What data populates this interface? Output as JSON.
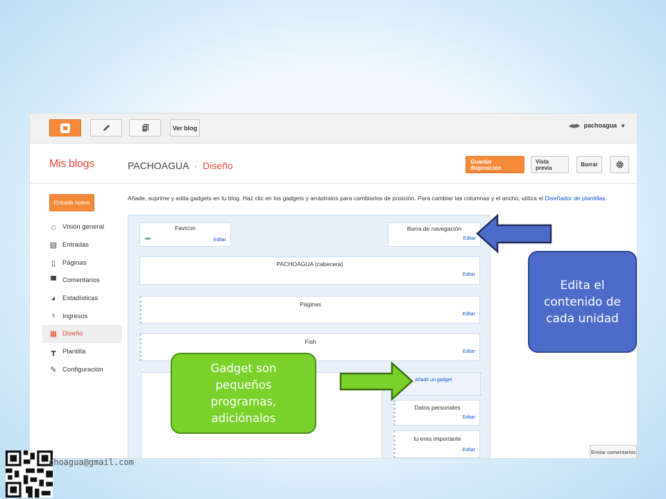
{
  "topbar": {
    "view_blog_label": "Ver blog",
    "username": "pachoagua",
    "dropdown_glyph": "▾",
    "icons": [
      "blogger-logo-icon",
      "pencil-icon",
      "pages-icon",
      "avatar-icon"
    ]
  },
  "header": {
    "brand": "Mis blogs",
    "blog_name": "PACHOAGUA",
    "separator": "·",
    "section": "Diseño",
    "save_label": "Guardar disposición",
    "preview_label": "Vista previa",
    "clear_label": "Borrar",
    "settings_icon": "gear-icon"
  },
  "sidebar": {
    "new_post_label": "Entrada nueva",
    "items": [
      {
        "label": "Visión general",
        "icon": "home-icon",
        "glyph": "⌂"
      },
      {
        "label": "Entradas",
        "icon": "posts-icon",
        "glyph": "▤"
      },
      {
        "label": "Páginas",
        "icon": "page-icon",
        "glyph": "▯"
      },
      {
        "label": "Comentarios",
        "icon": "comment-icon",
        "glyph": "▀"
      },
      {
        "label": "Estadísticas",
        "icon": "pie-chart-icon",
        "glyph": "◕"
      },
      {
        "label": "Ingresos",
        "icon": "trophy-icon",
        "glyph": "♆"
      },
      {
        "label": "Diseño",
        "icon": "layout-icon",
        "glyph": "▦",
        "active": true
      },
      {
        "label": "Plantilla",
        "icon": "paint-roller-icon",
        "glyph": "┳"
      },
      {
        "label": "Configuración",
        "icon": "wrench-icon",
        "glyph": "✎"
      }
    ]
  },
  "main": {
    "description": "Añade, suprime y edita gadgets en tu blog. Haz clic en los gadgets y arrástralos para cambiarlos de posición. Para cambiar las columnas y el ancho, utiliza el",
    "description_link": "Diseñador de plantillas",
    "description_end": ".",
    "edit_label": "Editar",
    "gadgets": {
      "favicon": "Favicon",
      "navbar": "Barra de navegación",
      "header": "PACHOAGUA (cabecera)",
      "pages": "Páginas",
      "fish": "Fish",
      "add_gadget": "Añadir un gadget",
      "profile": "Datos personales",
      "important": "tu eres importante"
    },
    "feedback_label": "Enviar comentarios"
  },
  "annotations": {
    "blue_callout": "Edita el contenido de cada unidad",
    "blue_color": "#4d6bc9",
    "green_callout": "Gadget son pequeños programas, adiciónalos",
    "green_color": "#7ad12a"
  },
  "footer": {
    "email": "choagua@gmail.com",
    "qr_icon": "qr-code-icon"
  }
}
